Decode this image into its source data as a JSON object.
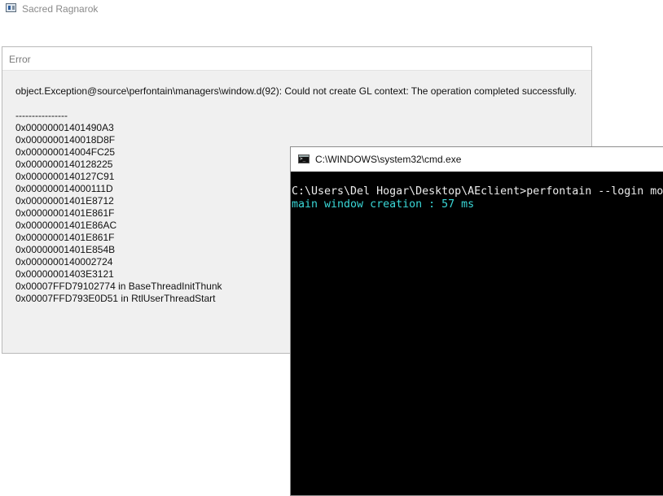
{
  "app": {
    "title": "Sacred Ragnarok",
    "icon": "app-window-icon"
  },
  "error_dialog": {
    "title": "Error",
    "message": "object.Exception@source\\perfontain\\managers\\window.d(92): Could not create GL context: The operation completed successfully.",
    "separator": "----------------",
    "stack_trace": [
      "0x00000001401490A3",
      "0x0000000140018D8F",
      "0x000000014004FC25",
      "0x0000000140128225",
      "0x0000000140127C91",
      "0x000000014000111D",
      "0x00000001401E8712",
      "0x00000001401E861F",
      "0x00000001401E86AC",
      "0x00000001401E861F",
      "0x00000001401E854B",
      "0x0000000140002724",
      "0x00000001403E3121",
      "0x00007FFD79102774 in BaseThreadInitThunk",
      "0x00007FFD793E0D51 in RtlUserThreadStart"
    ]
  },
  "cmd_window": {
    "title": "C:\\WINDOWS\\system32\\cmd.exe",
    "icon": "console-icon",
    "lines": [
      "C:\\Users\\Del Hogar\\Desktop\\AEclient>perfontain --login mo",
      "main window creation : 57 ms"
    ],
    "output_color": "#3ad8d8"
  }
}
